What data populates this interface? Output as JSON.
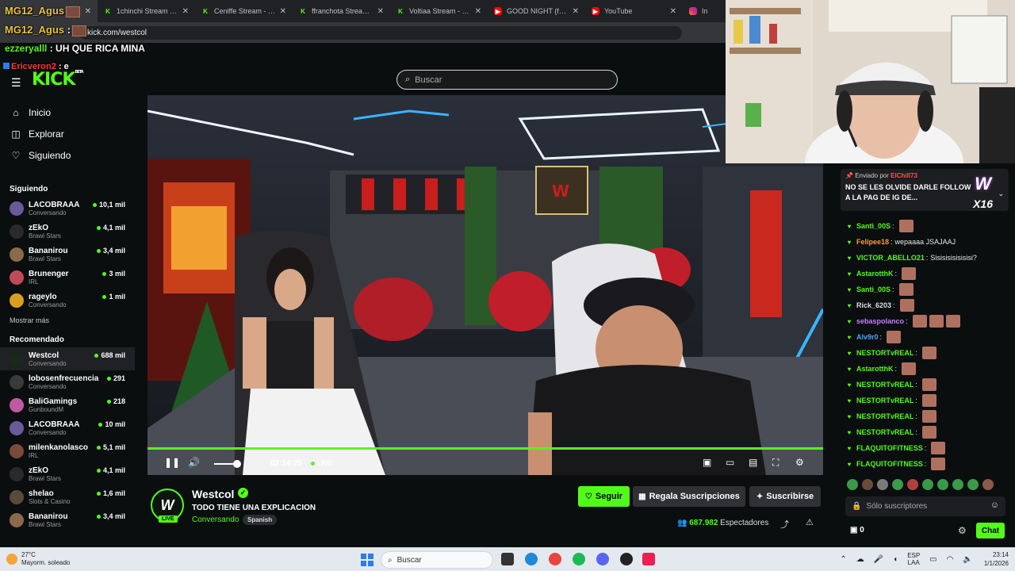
{
  "browser": {
    "tabs": [
      {
        "title": "",
        "icon": "speaker-icon",
        "kind": "spk",
        "active": true
      },
      {
        "title": "1chinchi Stream - Wa",
        "kind": "kick"
      },
      {
        "title": "Ceniffe Stream - Wat",
        "kind": "kick"
      },
      {
        "title": "ffranchota Stream - W",
        "kind": "kick"
      },
      {
        "title": "Voltiaa Stream - Wat",
        "kind": "kick"
      },
      {
        "title": "GOOD NIGHT (feat. I",
        "kind": "yt"
      },
      {
        "title": "YouTube",
        "kind": "yt"
      },
      {
        "title": "In",
        "kind": "ig"
      }
    ],
    "url": "kick.com/westcol"
  },
  "overlay_chat": [
    {
      "user": "MG12_Agus",
      "text": ""
    },
    {
      "user": "MG12_Agus",
      "text": ":"
    },
    {
      "user": "ezzeryalll",
      "text": ": UH QUE RICA MINA"
    },
    {
      "user": "Ericveron2",
      "text": ": e"
    }
  ],
  "header": {
    "logo": "KICK",
    "logo_sup": "BETA",
    "search_placeholder": "Buscar"
  },
  "sidebar": {
    "nav": [
      {
        "label": "Inicio",
        "icon": "home-icon",
        "glyph": "⌂"
      },
      {
        "label": "Explorar",
        "icon": "compass-icon",
        "glyph": "◫"
      },
      {
        "label": "Siguiendo",
        "icon": "heart-icon",
        "glyph": "♡"
      }
    ],
    "following_title": "Siguiendo",
    "following": [
      {
        "name": "LACOBRAAA",
        "category": "Conversando",
        "viewers": "10,1 mil",
        "color": "#6a5a9a"
      },
      {
        "name": "zEkO",
        "category": "Brawl Stars",
        "viewers": "4,1 mil",
        "color": "#2a2a2a"
      },
      {
        "name": "Bananirou",
        "category": "Brawl Stars",
        "viewers": "3,4 mil",
        "color": "#8a6a4a"
      },
      {
        "name": "Brunenger",
        "category": "IRL",
        "viewers": "3 mil",
        "color": "#c04a5a"
      },
      {
        "name": "rageylo",
        "category": "Conversando",
        "viewers": "1 mil",
        "color": "#d9a020"
      }
    ],
    "show_more": "Mostrar más",
    "recommended_title": "Recomendado",
    "recommended": [
      {
        "name": "Westcol",
        "category": "Conversando",
        "viewers": "688 mil",
        "color": "#1a2a1a",
        "selected": true
      },
      {
        "name": "lobosenfrecuencia",
        "category": "Conversando",
        "viewers": "291",
        "color": "#3a3a3a"
      },
      {
        "name": "BaliGamings",
        "category": "GunboundM",
        "viewers": "218",
        "color": "#c05aa0"
      },
      {
        "name": "LACOBRAAA",
        "category": "Conversando",
        "viewers": "10 mil",
        "color": "#6a5a9a"
      },
      {
        "name": "milenkanolasco",
        "category": "IRL",
        "viewers": "5,1 mil",
        "color": "#7a4a3a"
      },
      {
        "name": "zEkO",
        "category": "Brawl Stars",
        "viewers": "4,1 mil",
        "color": "#2a2a2a"
      },
      {
        "name": "shelao",
        "category": "Slots & Casino",
        "viewers": "1,6 mil",
        "color": "#5a4a3a"
      },
      {
        "name": "Bananirou",
        "category": "Brawl Stars",
        "viewers": "3,4 mil",
        "color": "#8a6a4a"
      }
    ]
  },
  "player": {
    "time": "02:14:25",
    "live_label": "LIVE",
    "volume_fraction": 0.55
  },
  "stream": {
    "name": "Westcol",
    "title": "TODO TIENE UNA EXPLICACION",
    "category": "Conversando",
    "tag": "Spanish",
    "live_badge": "LIVE",
    "follow": "Seguir",
    "gift": "Regala Suscripciones",
    "subscribe": "Suscribirse",
    "viewers": "687.982",
    "viewers_label": "Espectadores"
  },
  "chat": {
    "pinned_by_label": "Enviado por",
    "pinned_by": "ElChill73",
    "pinned_text": "NO SE LES OLVIDE DARLE FOLLOW A LA PAG DE IG DE...",
    "pinned_badge": "W",
    "pinned_badge_count": "X16",
    "messages": [
      {
        "user": "Santi_00S",
        "text": "",
        "color": "#53fc18",
        "emotes": 1
      },
      {
        "user": "Felipee18",
        "text": "wepaaaa JSAJAAJ",
        "color": "#ff9a3c",
        "emotes": 0
      },
      {
        "user": "VICTOR_ABELLO21",
        "text": "Sisisisisisisisi?",
        "color": "#53fc18",
        "emotes": 0
      },
      {
        "user": "AstarotthK",
        "text": "",
        "color": "#53fc18",
        "emotes": 1
      },
      {
        "user": "Santi_00S",
        "text": "",
        "color": "#53fc18",
        "emotes": 1
      },
      {
        "user": "Rick_6203",
        "text": "",
        "color": "#dddddd",
        "emotes": 1
      },
      {
        "user": "sebaspolanco",
        "text": "",
        "color": "#c77dff",
        "emotes": 3
      },
      {
        "user": "Alv9r0",
        "text": "",
        "color": "#4aa3ff",
        "emotes": 1
      },
      {
        "user": "NESTORTvREAL",
        "text": "",
        "color": "#53fc18",
        "emotes": 1
      },
      {
        "user": "AstarotthK",
        "text": "",
        "color": "#53fc18",
        "emotes": 1
      },
      {
        "user": "NESTORTvREAL",
        "text": "",
        "color": "#53fc18",
        "emotes": 1
      },
      {
        "user": "NESTORTvREAL",
        "text": "",
        "color": "#53fc18",
        "emotes": 1
      },
      {
        "user": "NESTORTvREAL",
        "text": "",
        "color": "#53fc18",
        "emotes": 1
      },
      {
        "user": "NESTORTvREAL",
        "text": "",
        "color": "#53fc18",
        "emotes": 1
      },
      {
        "user": "FLAQUITOFITNESS",
        "text": "",
        "color": "#53fc18",
        "emotes": 1
      },
      {
        "user": "FLAQUITOFITNESS",
        "text": "",
        "color": "#53fc18",
        "emotes": 1
      }
    ],
    "input_placeholder": "Sólo suscriptores",
    "points": "0",
    "send_label": "Chat"
  },
  "taskbar": {
    "weather_temp": "27°C",
    "weather_desc": "Mayorm. soleado",
    "search": "Buscar",
    "lang_top": "ESP",
    "lang_bottom": "LAA",
    "time": "23:14",
    "date": "1/1/2026"
  },
  "colors": {
    "kick_green": "#53fc18",
    "background": "#0b0e0f"
  }
}
